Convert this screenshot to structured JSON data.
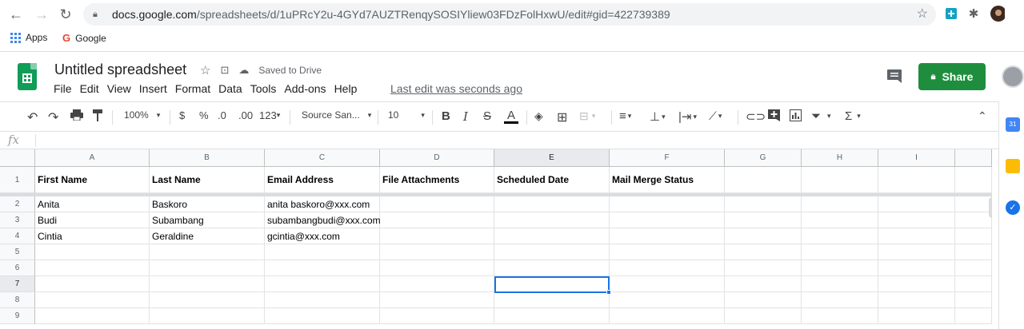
{
  "browser": {
    "url_host": "docs.google.com",
    "url_path": "/spreadsheets/d/1uPRcY2u-4GYd7AUZTRenqySOSIYliew03FDzFolHxwU/edit#gid=422739389",
    "bookmarks": [
      {
        "label": "Apps"
      },
      {
        "label": "Google"
      }
    ]
  },
  "sheets": {
    "doc_title": "Untitled spreadsheet",
    "saved_status": "Saved to Drive",
    "menus": [
      "File",
      "Edit",
      "View",
      "Insert",
      "Format",
      "Data",
      "Tools",
      "Add-ons",
      "Help"
    ],
    "last_edit": "Last edit was seconds ago",
    "share_label": "Share",
    "brand_color": "#1e8e3e"
  },
  "toolbar": {
    "zoom": "100%",
    "currency": "$",
    "percent": "%",
    "dec_decrease": ".0",
    "dec_increase": ".00",
    "more_formats": "123",
    "font": "Source San...",
    "font_size": "10",
    "bold": "B",
    "italic": "I",
    "strike": "S",
    "text_color": "A"
  },
  "formula_bar": {
    "fx": "fx",
    "value": ""
  },
  "grid": {
    "columns": [
      {
        "label": "A"
      },
      {
        "label": "B"
      },
      {
        "label": "C"
      },
      {
        "label": "D"
      },
      {
        "label": "E"
      },
      {
        "label": "F"
      },
      {
        "label": "G"
      },
      {
        "label": "H"
      },
      {
        "label": "I"
      }
    ],
    "rows": [
      {
        "num": "1",
        "cells": [
          "First Name",
          "Last Name",
          "Email Address",
          "File Attachments",
          "Scheduled Date",
          "Mail Merge Status",
          "",
          "",
          ""
        ]
      },
      {
        "num": "2",
        "cells": [
          "Anita",
          "Baskoro",
          "anita baskoro@xxx.com",
          "",
          "",
          "",
          "",
          "",
          ""
        ]
      },
      {
        "num": "3",
        "cells": [
          "Budi",
          "Subambang",
          "subambangbudi@xxx.com",
          "",
          "",
          "",
          "",
          "",
          ""
        ]
      },
      {
        "num": "4",
        "cells": [
          "Cintia",
          "Geraldine",
          "gcintia@xxx.com",
          "",
          "",
          "",
          "",
          "",
          ""
        ]
      },
      {
        "num": "5",
        "cells": [
          "",
          "",
          "",
          "",
          "",
          "",
          "",
          "",
          ""
        ]
      },
      {
        "num": "6",
        "cells": [
          "",
          "",
          "",
          "",
          "",
          "",
          "",
          "",
          ""
        ]
      },
      {
        "num": "7",
        "cells": [
          "",
          "",
          "",
          "",
          "",
          "",
          "",
          "",
          ""
        ]
      },
      {
        "num": "8",
        "cells": [
          "",
          "",
          "",
          "",
          "",
          "",
          "",
          "",
          ""
        ]
      },
      {
        "num": "9",
        "cells": [
          "",
          "",
          "",
          "",
          "",
          "",
          "",
          "",
          ""
        ]
      }
    ],
    "active_cell": "E7"
  }
}
